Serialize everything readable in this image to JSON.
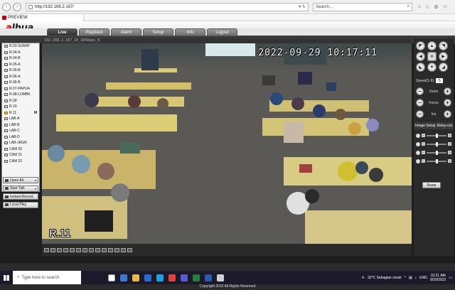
{
  "browser": {
    "url": "http://192.168.2.167/",
    "search_placeholder": "Search...",
    "tab_title": "PREVIEW"
  },
  "app": {
    "logo_main": "alhua",
    "nav_tabs": [
      "Live",
      "Playback",
      "Alarm",
      "Setup",
      "Info",
      "Logout"
    ],
    "active_tab": "Live",
    "channels": [
      {
        "label": "R.03-SUMAT",
        "live": false
      },
      {
        "label": "R.04-A",
        "live": false
      },
      {
        "label": "R.04-B",
        "live": false
      },
      {
        "label": "R.05-A",
        "live": false
      },
      {
        "label": "R.05-B",
        "live": false
      },
      {
        "label": "R.06-A",
        "live": false
      },
      {
        "label": "R.06-B",
        "live": false
      },
      {
        "label": "R.07-PAPUA",
        "live": false
      },
      {
        "label": "R.08-LOMBK",
        "live": false
      },
      {
        "label": "R.09",
        "live": false
      },
      {
        "label": "R.10",
        "live": false
      },
      {
        "label": "R.11",
        "live": true,
        "marker": "M"
      },
      {
        "label": "LAB-A",
        "live": false
      },
      {
        "label": "LAB-B",
        "live": false
      },
      {
        "label": "LAB-C",
        "live": false
      },
      {
        "label": "LAB-D",
        "live": false
      },
      {
        "label": "LAB-JRGN",
        "live": false
      },
      {
        "label": "CAM 20",
        "live": false
      },
      {
        "label": "CAM 21",
        "live": false
      },
      {
        "label": "CAM 22",
        "live": false
      }
    ],
    "side_buttons": [
      "Open All",
      "Start Talk",
      "Instant Record",
      "Local Play"
    ],
    "video_title": "192.168.2.167_16_185kbps_R",
    "timestamp": "2022-09-29 10:17:11",
    "channel_label": "R.11",
    "ptz": {
      "speed_label": "Speed(1-8):",
      "speed_value": "5",
      "zoom_label": "Zoom",
      "focus_label": "Focus",
      "iris_label": "Iris",
      "image_setup": "Image Setup",
      "relay_out": "Relay-out",
      "reset_label": "Reset",
      "sliders": [
        0.48,
        0.48,
        0.48,
        0.48
      ]
    },
    "footer": "Copyright 2015 All Rights Reserved"
  },
  "taskbar": {
    "search_placeholder": "Type here to search",
    "weather": "32°C  Sebagian cerah",
    "lang": "ENG",
    "time": "10:21 AM",
    "date": "9/29/2022"
  }
}
